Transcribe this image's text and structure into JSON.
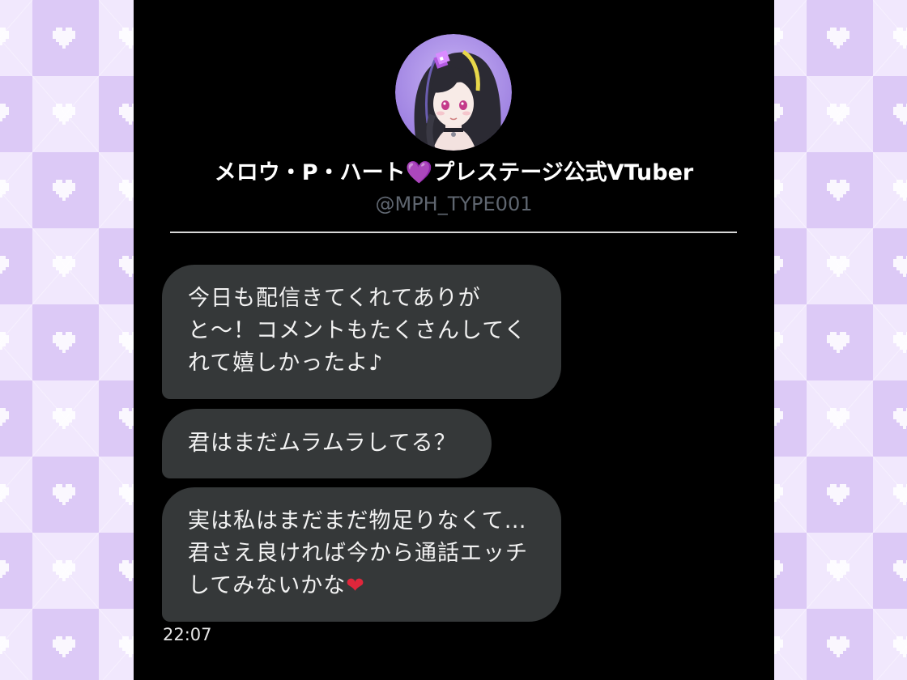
{
  "profile": {
    "display_name": "メロウ・P・ハート",
    "name_icon": "💜",
    "name_suffix": "プレステージ公式VTuber",
    "handle": "@MPH_TYPE001"
  },
  "messages": [
    {
      "lines": [
        "今日も配信きてくれてありが",
        "と～！コメントもたくさんしてく",
        "れて嬉しかったよ♪"
      ]
    },
    {
      "lines": [
        "君はまだムラムラしてる？"
      ]
    },
    {
      "lines": [
        "実は私はまだまだ物足りなくて…",
        "君さえ良ければ今から通話エッチ",
        "してみないかな"
      ],
      "end_icon": "❤"
    }
  ],
  "timestamp": "22:07",
  "icons": {
    "avatar": "avatar-portrait-icon",
    "name_icon": "purple-heart-icon",
    "end_icon": "red-heart-icon",
    "background_pattern": "pixel-heart-icon"
  },
  "colors": {
    "background": "#000000",
    "bubble": "#353839",
    "text": "#f2f2f2",
    "handle": "#5f6670",
    "pattern_light": "#f1e8fd",
    "pattern_dark": "#dcc9f6",
    "avatar_ring": "#a98be6"
  }
}
